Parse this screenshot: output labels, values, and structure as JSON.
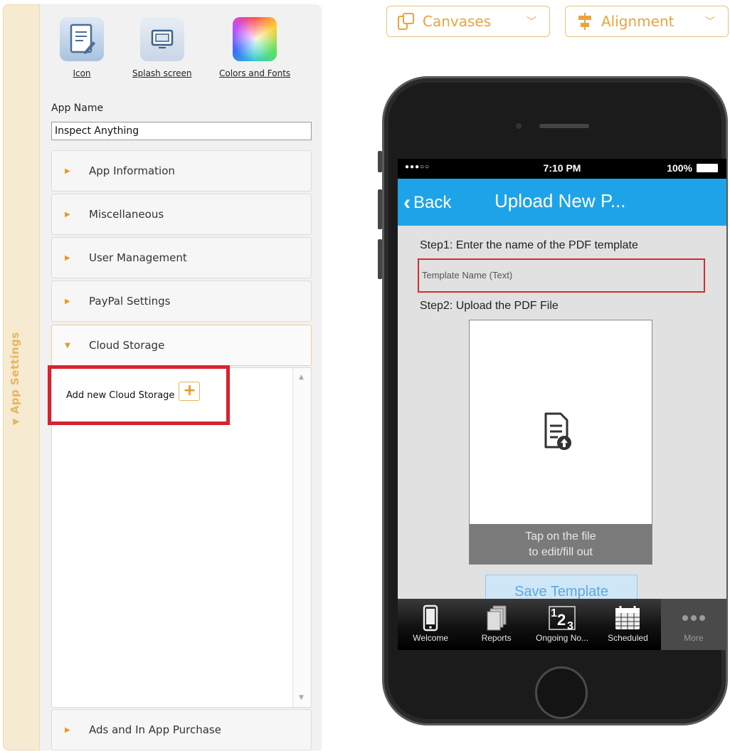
{
  "sidebar_tab": {
    "label": "App Settings"
  },
  "tools": [
    {
      "label": "Icon",
      "icon": "document-edit-icon"
    },
    {
      "label": "Splash screen",
      "icon": "splash-screen-icon"
    },
    {
      "label": "Colors and Fonts",
      "icon": "color-palette-icon"
    }
  ],
  "app_name": {
    "label": "App Name",
    "value": "Inspect Anything"
  },
  "sections": [
    {
      "label": "App Information",
      "expanded": false
    },
    {
      "label": "Miscellaneous",
      "expanded": false
    },
    {
      "label": "User Management",
      "expanded": false
    },
    {
      "label": "PayPal Settings",
      "expanded": false
    },
    {
      "label": "Cloud Storage",
      "expanded": true
    },
    {
      "label": "Ads and In App Purchase",
      "expanded": false
    }
  ],
  "cloud_storage": {
    "add_label": "Add new Cloud Storage",
    "add_button": "+"
  },
  "toolbar": {
    "canvases": {
      "label": "Canvases",
      "icon": "canvases-icon"
    },
    "alignment": {
      "label": "Alignment",
      "icon": "alignment-icon"
    }
  },
  "phone": {
    "status": {
      "signal": "●●●○○",
      "time": "7:10 PM",
      "battery": "100%"
    },
    "nav": {
      "back": "Back",
      "title": "Upload New P..."
    },
    "step1": "Step1: Enter the name of the PDF template",
    "template_placeholder": "Template Name (Text)",
    "step2": "Step2: Upload the PDF File",
    "tap_hint_line1": "Tap on the file",
    "tap_hint_line2": "to edit/fill out",
    "save_button": "Save Template",
    "tabs": [
      {
        "label": "Welcome",
        "icon": "phone-icon"
      },
      {
        "label": "Reports",
        "icon": "reports-icon"
      },
      {
        "label": "Ongoing No...",
        "icon": "numbers-icon"
      },
      {
        "label": "Scheduled",
        "icon": "calendar-icon"
      },
      {
        "label": "More",
        "icon": "more-dots-icon"
      }
    ]
  },
  "colors": {
    "accent": "#e9a43e",
    "highlight": "#d7232e",
    "ios_blue": "#1fa3e8"
  }
}
